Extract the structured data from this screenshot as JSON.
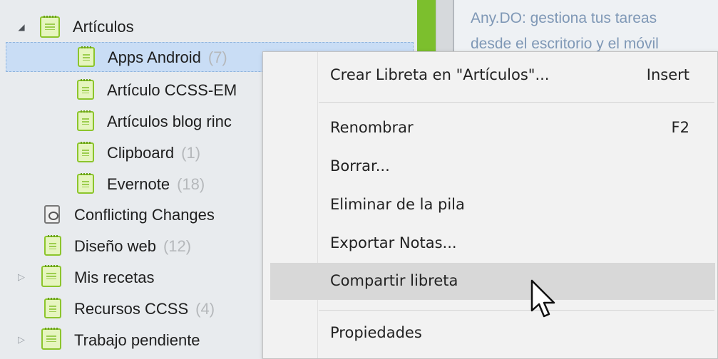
{
  "tree": {
    "items": [
      {
        "label": "Artículos",
        "count": ""
      },
      {
        "label": "Apps Android",
        "count": "(7)"
      },
      {
        "label": "Artículo CCSS-EM",
        "count": ""
      },
      {
        "label": "Artículos blog rinc",
        "count": ""
      },
      {
        "label": "Clipboard",
        "count": "(1)"
      },
      {
        "label": "Evernote",
        "count": "(18)"
      },
      {
        "label": "Conflicting Changes",
        "count": ""
      },
      {
        "label": "Diseño web",
        "count": "(12)"
      },
      {
        "label": "Mis recetas",
        "count": ""
      },
      {
        "label": "Recursos CCSS",
        "count": "(4)"
      },
      {
        "label": "Trabajo pendiente",
        "count": ""
      }
    ],
    "selected": "Apps Android"
  },
  "note_preview": {
    "line1": "Any.DO: gestiona tus tareas",
    "line2": "desde el escritorio y el móvil"
  },
  "context_menu": {
    "items": [
      {
        "label": "Crear Libreta en \"Artículos\"...",
        "shortcut": "Insert"
      },
      {
        "label": "Renombrar",
        "shortcut": "F2"
      },
      {
        "label": "Borrar...",
        "shortcut": ""
      },
      {
        "label": "Eliminar de la pila",
        "shortcut": ""
      },
      {
        "label": "Exportar Notas...",
        "shortcut": ""
      },
      {
        "label": "Compartir libreta",
        "shortcut": ""
      },
      {
        "label": "Propiedades",
        "shortcut": ""
      }
    ],
    "hovered": "Compartir libreta"
  },
  "colors": {
    "accent_green": "#7cbf2d",
    "selection": "#c9ddf5",
    "menu_hover": "#d8d8d8"
  },
  "icons": {
    "notebook": "notebook-icon",
    "conflict": "conflict-notebook-icon",
    "expand": "triangle-right-icon",
    "collapse": "triangle-down-icon",
    "pointer": "mouse-cursor-icon"
  }
}
